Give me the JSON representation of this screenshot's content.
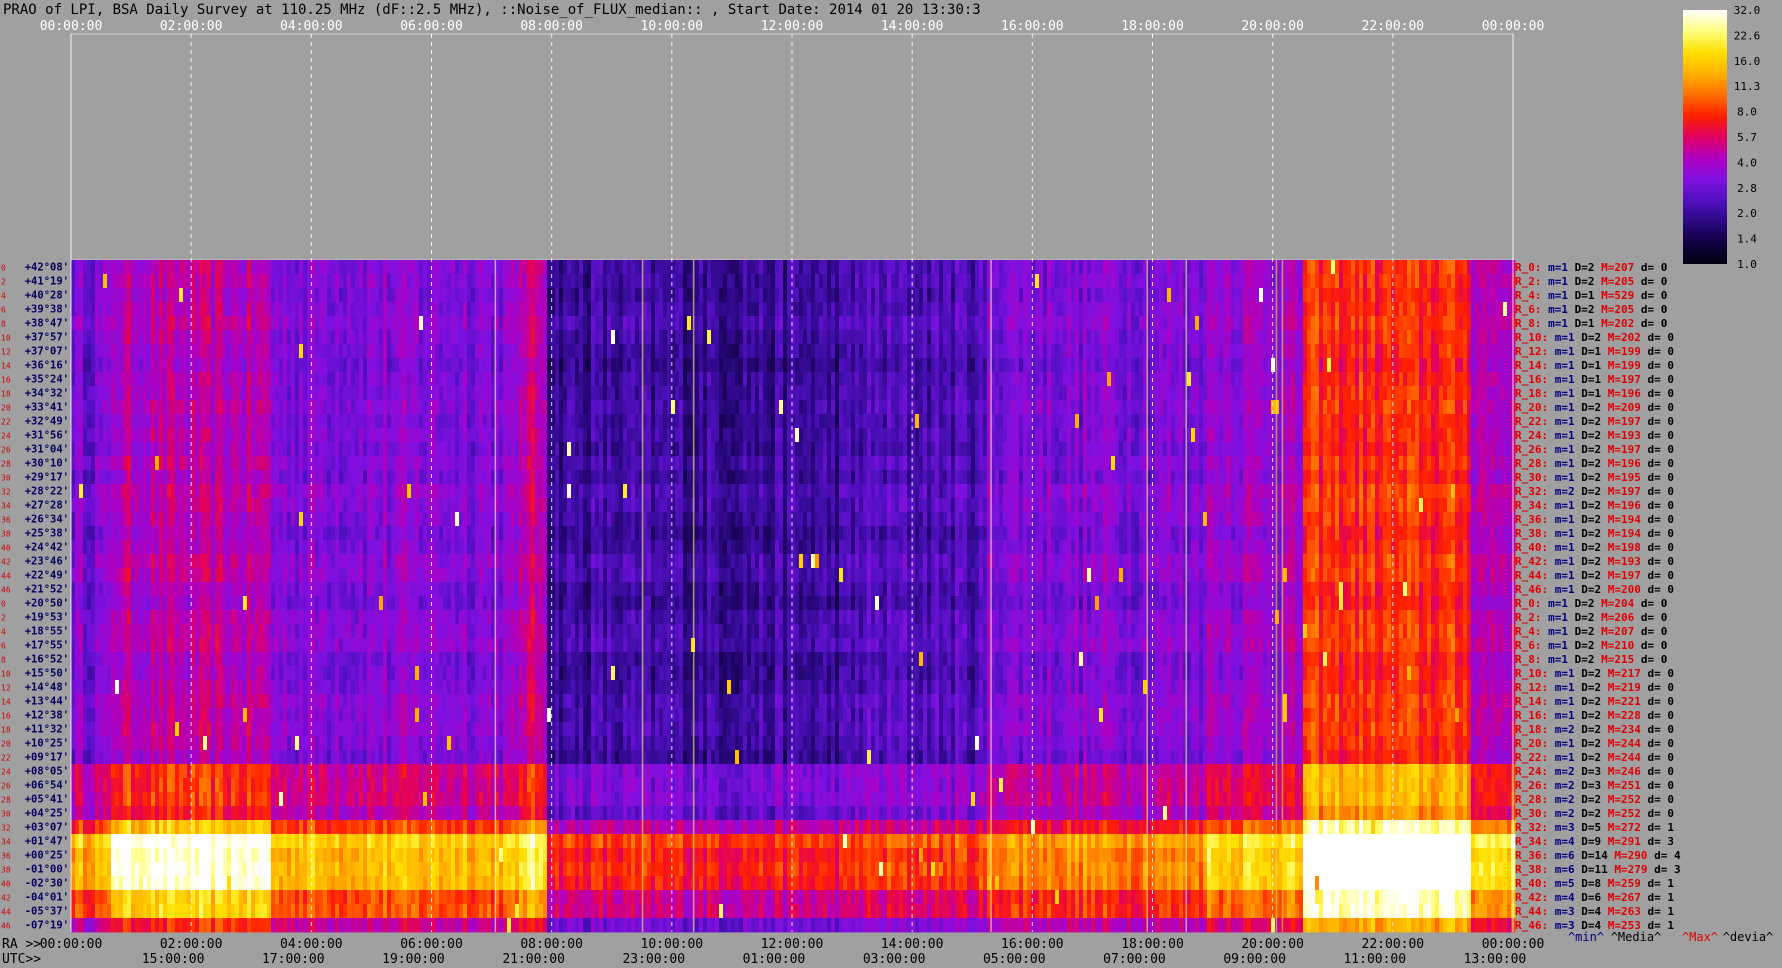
{
  "header": {
    "title": "PRAO of LPI, BSA Daily Survey at 110.25 MHz (dF::2.5 MHz), ::Noise_of_FLUX_median:: , Start Date: 2014 01 20 13:30:3"
  },
  "chart_data": {
    "type": "heatmap",
    "title": "PRAO of LPI, BSA Daily Survey at 110.25 MHz (dF::2.5 MHz), ::Noise_of_FLUX_median:: , Start Date: 2014 01 20 13:30:3",
    "ra_ticks_top": [
      "00:00:00",
      "02:00:00",
      "04:00:00",
      "06:00:00",
      "08:00:00",
      "10:00:00",
      "12:00:00",
      "14:00:00",
      "16:00:00",
      "18:00:00",
      "20:00:00",
      "22:00:00",
      "00:00:00"
    ],
    "ra_ticks_bottom": [
      "00:00:00",
      "02:00:00",
      "04:00:00",
      "06:00:00",
      "08:00:00",
      "10:00:00",
      "12:00:00",
      "14:00:00",
      "16:00:00",
      "18:00:00",
      "20:00:00",
      "22:00:00",
      "00:00:00"
    ],
    "utc_ticks": [
      "15:00:00",
      "17:00:00",
      "19:00:00",
      "21:00:00",
      "23:00:00",
      "01:00:00",
      "03:00:00",
      "05:00:00",
      "07:00:00",
      "09:00:00",
      "11:00:00",
      "13:00:00"
    ],
    "axis_prefix_ra": "RA >>",
    "axis_prefix_utc": "UTC>>",
    "declinations": [
      "+42°08'",
      "+41°19'",
      "+40°28'",
      "+39°38'",
      "+38°47'",
      "+37°57'",
      "+37°07'",
      "+36°16'",
      "+35°24'",
      "+34°32'",
      "+33°41'",
      "+32°49'",
      "+31°56'",
      "+31°04'",
      "+30°10'",
      "+29°17'",
      "+28°22'",
      "+27°28'",
      "+26°34'",
      "+25°38'",
      "+24°42'",
      "+23°46'",
      "+22°49'",
      "+21°52'",
      "+20°50'",
      "+19°53'",
      "+18°55'",
      "+17°55'",
      "+16°52'",
      "+15°50'",
      "+14°48'",
      "+13°44'",
      "+12°38'",
      "+11°32'",
      "+10°25'",
      "+09°17'",
      "+08°05'",
      "+06°54'",
      "+05°41'",
      "+04°25'",
      "+03°07'",
      "+01°47'",
      "+00°25'",
      "-01°00'",
      "-02°30'",
      "-04°01'",
      "-05°37'",
      "-07°19'"
    ],
    "row_indices": [
      "0",
      "2",
      "4",
      "6",
      "8",
      "10",
      "12",
      "14",
      "16",
      "18",
      "20",
      "22",
      "24",
      "26",
      "28",
      "30",
      "32",
      "34",
      "36",
      "38",
      "40",
      "42",
      "44",
      "46",
      "0",
      "2",
      "4",
      "6",
      "8",
      "10",
      "12",
      "14",
      "16",
      "18",
      "20",
      "22",
      "24",
      "26",
      "28",
      "30",
      "32",
      "34",
      "36",
      "38",
      "40",
      "42",
      "44",
      "46"
    ],
    "row_stats": [
      {
        "r": "R_0:",
        "m": "m=1",
        "D": "D=2",
        "M": "M=207",
        "d": "d= 0"
      },
      {
        "r": "R_2:",
        "m": "m=1",
        "D": "D=2",
        "M": "M=205",
        "d": "d= 0"
      },
      {
        "r": "R_4:",
        "m": "m=1",
        "D": "D=1",
        "M": "M=529",
        "d": "d= 0"
      },
      {
        "r": "R_6:",
        "m": "m=1",
        "D": "D=2",
        "M": "M=205",
        "d": "d= 0"
      },
      {
        "r": "R_8:",
        "m": "m=1",
        "D": "D=1",
        "M": "M=202",
        "d": "d= 0"
      },
      {
        "r": "R_10:",
        "m": "m=1",
        "D": "D=2",
        "M": "M=202",
        "d": "d= 0"
      },
      {
        "r": "R_12:",
        "m": "m=1",
        "D": "D=1",
        "M": "M=199",
        "d": "d= 0"
      },
      {
        "r": "R_14:",
        "m": "m=1",
        "D": "D=1",
        "M": "M=199",
        "d": "d= 0"
      },
      {
        "r": "R_16:",
        "m": "m=1",
        "D": "D=1",
        "M": "M=197",
        "d": "d= 0"
      },
      {
        "r": "R_18:",
        "m": "m=1",
        "D": "D=1",
        "M": "M=196",
        "d": "d= 0"
      },
      {
        "r": "R_20:",
        "m": "m=1",
        "D": "D=2",
        "M": "M=209",
        "d": "d= 0"
      },
      {
        "r": "R_22:",
        "m": "m=1",
        "D": "D=2",
        "M": "M=197",
        "d": "d= 0"
      },
      {
        "r": "R_24:",
        "m": "m=1",
        "D": "D=2",
        "M": "M=193",
        "d": "d= 0"
      },
      {
        "r": "R_26:",
        "m": "m=1",
        "D": "D=2",
        "M": "M=197",
        "d": "d= 0"
      },
      {
        "r": "R_28:",
        "m": "m=1",
        "D": "D=2",
        "M": "M=196",
        "d": "d= 0"
      },
      {
        "r": "R_30:",
        "m": "m=1",
        "D": "D=2",
        "M": "M=195",
        "d": "d= 0"
      },
      {
        "r": "R_32:",
        "m": "m=2",
        "D": "D=2",
        "M": "M=197",
        "d": "d= 0"
      },
      {
        "r": "R_34:",
        "m": "m=1",
        "D": "D=2",
        "M": "M=196",
        "d": "d= 0"
      },
      {
        "r": "R_36:",
        "m": "m=1",
        "D": "D=2",
        "M": "M=194",
        "d": "d= 0"
      },
      {
        "r": "R_38:",
        "m": "m=1",
        "D": "D=2",
        "M": "M=194",
        "d": "d= 0"
      },
      {
        "r": "R_40:",
        "m": "m=1",
        "D": "D=2",
        "M": "M=198",
        "d": "d= 0"
      },
      {
        "r": "R_42:",
        "m": "m=1",
        "D": "D=2",
        "M": "M=193",
        "d": "d= 0"
      },
      {
        "r": "R_44:",
        "m": "m=1",
        "D": "D=2",
        "M": "M=197",
        "d": "d= 0"
      },
      {
        "r": "R_46:",
        "m": "m=1",
        "D": "D=2",
        "M": "M=200",
        "d": "d= 0"
      },
      {
        "r": "R_0:",
        "m": "m=1",
        "D": "D=2",
        "M": "M=204",
        "d": "d= 0"
      },
      {
        "r": "R_2:",
        "m": "m=1",
        "D": "D=2",
        "M": "M=206",
        "d": "d= 0"
      },
      {
        "r": "R_4:",
        "m": "m=1",
        "D": "D=2",
        "M": "M=207",
        "d": "d= 0"
      },
      {
        "r": "R_6:",
        "m": "m=1",
        "D": "D=2",
        "M": "M=210",
        "d": "d= 0"
      },
      {
        "r": "R_8:",
        "m": "m=1",
        "D": "D=2",
        "M": "M=215",
        "d": "d= 0"
      },
      {
        "r": "R_10:",
        "m": "m=1",
        "D": "D=2",
        "M": "M=217",
        "d": "d= 0"
      },
      {
        "r": "R_12:",
        "m": "m=1",
        "D": "D=2",
        "M": "M=219",
        "d": "d= 0"
      },
      {
        "r": "R_14:",
        "m": "m=1",
        "D": "D=2",
        "M": "M=221",
        "d": "d= 0"
      },
      {
        "r": "R_16:",
        "m": "m=1",
        "D": "D=2",
        "M": "M=228",
        "d": "d= 0"
      },
      {
        "r": "R_18:",
        "m": "m=2",
        "D": "D=2",
        "M": "M=234",
        "d": "d= 0"
      },
      {
        "r": "R_20:",
        "m": "m=1",
        "D": "D=2",
        "M": "M=244",
        "d": "d= 0"
      },
      {
        "r": "R_22:",
        "m": "m=1",
        "D": "D=2",
        "M": "M=244",
        "d": "d= 0"
      },
      {
        "r": "R_24:",
        "m": "m=2",
        "D": "D=3",
        "M": "M=246",
        "d": "d= 0"
      },
      {
        "r": "R_26:",
        "m": "m=2",
        "D": "D=3",
        "M": "M=251",
        "d": "d= 0"
      },
      {
        "r": "R_28:",
        "m": "m=2",
        "D": "D=2",
        "M": "M=252",
        "d": "d= 0"
      },
      {
        "r": "R_30:",
        "m": "m=2",
        "D": "D=2",
        "M": "M=252",
        "d": "d= 0"
      },
      {
        "r": "R_32:",
        "m": "m=3",
        "D": "D=5",
        "M": "M=272",
        "d": "d= 1"
      },
      {
        "r": "R_34:",
        "m": "m=4",
        "D": "D=9",
        "M": "M=291",
        "d": "d= 3"
      },
      {
        "r": "R_36:",
        "m": "m=6",
        "D": "D=14",
        "M": "M=290",
        "d": "d= 4"
      },
      {
        "r": "R_38:",
        "m": "m=6",
        "D": "D=11",
        "M": "M=279",
        "d": "d= 3"
      },
      {
        "r": "R_40:",
        "m": "m=5",
        "D": "D=8",
        "M": "M=259",
        "d": "d= 1"
      },
      {
        "r": "R_42:",
        "m": "m=4",
        "D": "D=6",
        "M": "M=267",
        "d": "d= 1"
      },
      {
        "r": "R_44:",
        "m": "m=3",
        "D": "D=4",
        "M": "M=263",
        "d": "d= 1"
      },
      {
        "r": "R_46:",
        "m": "m=3",
        "D": "D=4",
        "M": "M=253",
        "d": "d= 1"
      }
    ],
    "colorbar_ticks": [
      "32.0",
      "22.6",
      "16.0",
      "11.3",
      "8.0",
      "5.7",
      "4.0",
      "2.8",
      "2.0",
      "1.4",
      "1.0"
    ],
    "colorscale": [
      "#000010",
      "#100040",
      "#2a0880",
      "#5010c0",
      "#8010e0",
      "#b000c0",
      "#e00060",
      "#ff2000",
      "#ff7000",
      "#ffb000",
      "#ffe000",
      "#ffff80",
      "#ffffff"
    ],
    "stat_legend": [
      "^min^",
      "^Media^",
      "^Max^",
      "^devia^"
    ],
    "colors": {
      "min": "#000080",
      "media": "#000000",
      "max": "#e00000",
      "devia": "#000000",
      "index_red": "#d00000"
    }
  }
}
